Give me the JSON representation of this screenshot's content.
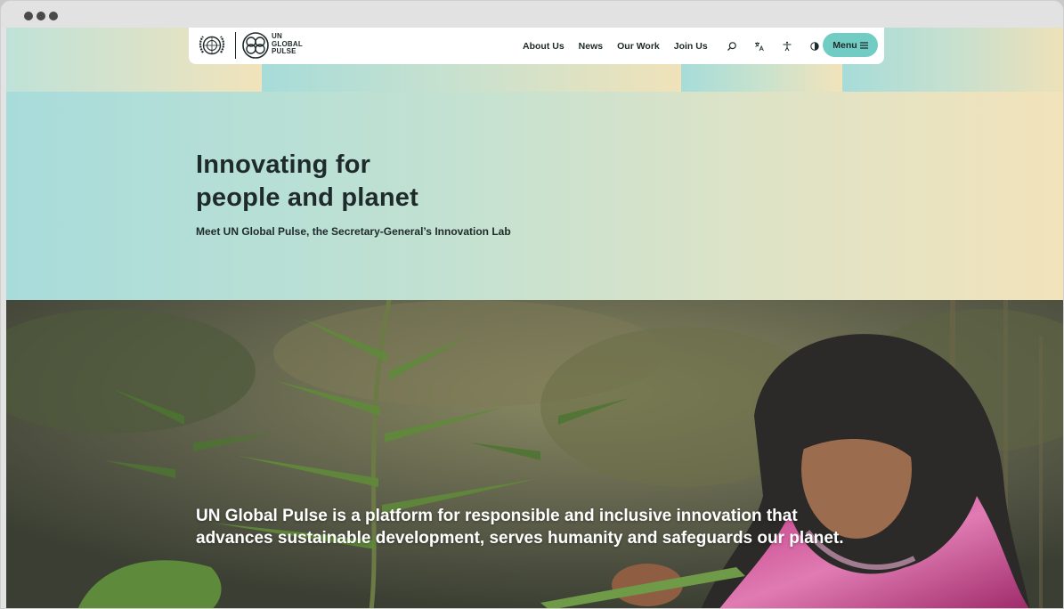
{
  "brand": {
    "name_lines": [
      "UN",
      "GLOBAL",
      "PULSE"
    ]
  },
  "nav": {
    "items": [
      "About Us",
      "News",
      "Our Work",
      "Join Us"
    ],
    "icons": [
      "search-icon",
      "translate-icon",
      "accessibility-icon",
      "theme-icon"
    ],
    "menu_label": "Menu",
    "menu_icon": "hamburger-icon"
  },
  "hero": {
    "title_lines": [
      "Innovating for",
      "people and planet"
    ],
    "subtitle": "Meet UN Global Pulse, the Secretary-General’s Innovation Lab"
  },
  "feature": {
    "statement_lines": [
      "UN Global Pulse is a platform for responsible and inclusive innovation that",
      "advances sustainable development, serves humanity and safeguards our planet."
    ]
  },
  "colors": {
    "accent": "#71cdc4",
    "hero_start": "#a8dcdb",
    "hero_end": "#f2e3bb",
    "text": "#1f2a2a"
  }
}
